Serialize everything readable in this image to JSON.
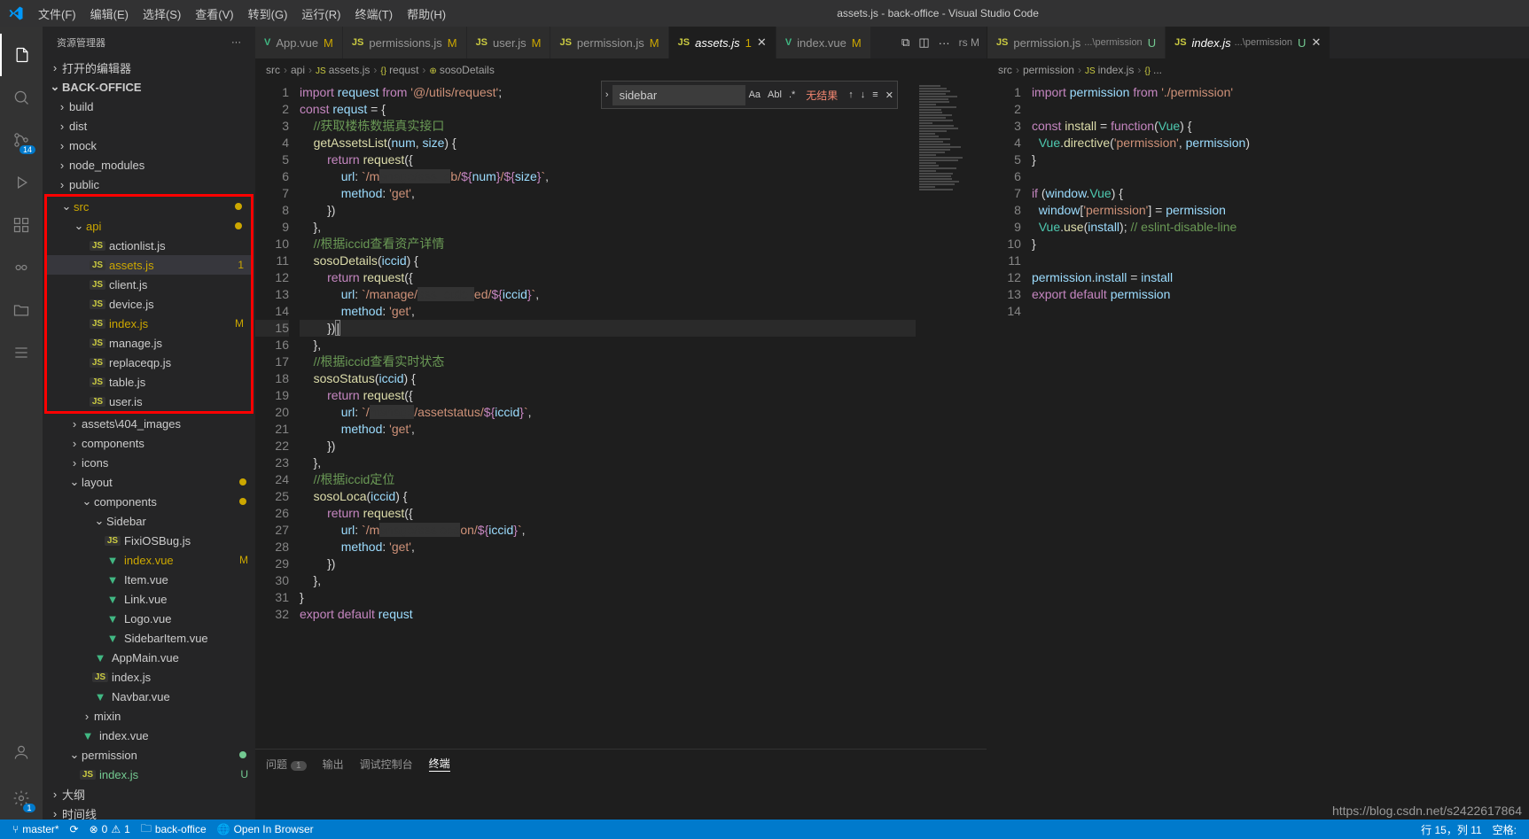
{
  "window_title": "assets.js - back-office - Visual Studio Code",
  "menu": [
    "文件(F)",
    "编辑(E)",
    "选择(S)",
    "查看(V)",
    "转到(G)",
    "运行(R)",
    "终端(T)",
    "帮助(H)"
  ],
  "activitybar": {
    "scm_badge": "14",
    "gear_badge": "1"
  },
  "sidebar": {
    "title": "资源管理器",
    "open_editors": "打开的编辑器",
    "workspace": "BACK-OFFICE",
    "folders_top": [
      "build",
      "dist",
      "mock",
      "node_modules",
      "public"
    ],
    "src": "src",
    "api": "api",
    "api_files": [
      {
        "n": "actionlist.js"
      },
      {
        "n": "assets.js",
        "sel": true,
        "b": "1"
      },
      {
        "n": "client.js"
      },
      {
        "n": "device.js"
      },
      {
        "n": "index.js",
        "b": "M"
      },
      {
        "n": "manage.js"
      },
      {
        "n": "replaceqp.js"
      },
      {
        "n": "table.js"
      },
      {
        "n": "user.is"
      }
    ],
    "after": [
      {
        "n": "assets\\404_images",
        "t": "folder",
        "ch": ">"
      },
      {
        "n": "components",
        "t": "folder",
        "ch": ">"
      },
      {
        "n": "icons",
        "t": "folder",
        "ch": ">"
      },
      {
        "n": "layout",
        "t": "folder",
        "ch": "v",
        "dot": "#cca700"
      },
      {
        "n": "components",
        "t": "folder",
        "ch": "v",
        "pad": 1,
        "dot": "#cca700"
      },
      {
        "n": "Sidebar",
        "t": "folder",
        "ch": "v",
        "pad": 2
      },
      {
        "n": "FixiOSBug.js",
        "t": "js",
        "pad": 3
      },
      {
        "n": "index.vue",
        "t": "vue",
        "pad": 3,
        "b": "M"
      },
      {
        "n": "Item.vue",
        "t": "vue",
        "pad": 3
      },
      {
        "n": "Link.vue",
        "t": "vue",
        "pad": 3
      },
      {
        "n": "Logo.vue",
        "t": "vue",
        "pad": 3
      },
      {
        "n": "SidebarItem.vue",
        "t": "vue",
        "pad": 3
      },
      {
        "n": "AppMain.vue",
        "t": "vue",
        "pad": 2
      },
      {
        "n": "index.js",
        "t": "js",
        "pad": 2
      },
      {
        "n": "Navbar.vue",
        "t": "vue",
        "pad": 2
      },
      {
        "n": "mixin",
        "t": "folder",
        "ch": ">",
        "pad": 1
      },
      {
        "n": "index.vue",
        "t": "vue",
        "pad": 1
      },
      {
        "n": "permission",
        "t": "folder",
        "ch": "v",
        "dot": "#73c991"
      },
      {
        "n": "index.js",
        "t": "js",
        "pad": 1,
        "b": "U",
        "bc": "#73c991"
      }
    ],
    "outline": "大纲",
    "timeline": "时间线"
  },
  "tabs1": [
    {
      "i": "V",
      "ic": "#41b883",
      "n": "App.vue",
      "m": "M"
    },
    {
      "i": "JS",
      "ic": "#cbcb41",
      "n": "permissions.js",
      "m": "M"
    },
    {
      "i": "JS",
      "ic": "#cbcb41",
      "n": "user.js",
      "m": "M"
    },
    {
      "i": "JS",
      "ic": "#cbcb41",
      "n": "permission.js",
      "m": "M"
    },
    {
      "i": "JS",
      "ic": "#cbcb41",
      "n": "assets.js",
      "m": "1",
      "active": true,
      "close": true
    },
    {
      "i": "V",
      "ic": "#41b883",
      "n": "index.vue",
      "m": "M"
    }
  ],
  "tabs1_over": "rs  M",
  "tabs2": [
    {
      "i": "JS",
      "ic": "#cbcb41",
      "n": "permission.js",
      "sub": "...\\permission",
      "m": "U",
      "mc": "#73c991"
    },
    {
      "i": "JS",
      "ic": "#cbcb41",
      "n": "index.js",
      "sub": "...\\permission",
      "m": "U",
      "mc": "#73c991",
      "active": true,
      "close": true
    }
  ],
  "breadcrumb1": [
    "src",
    "api",
    "assets.js",
    "requst",
    "sosoDetails"
  ],
  "breadcrumb2": [
    "src",
    "permission",
    "index.js",
    "..."
  ],
  "find": {
    "value": "sidebar",
    "result": "无结果",
    "opts": [
      "Aa",
      "Abl",
      ".*"
    ]
  },
  "code1": [
    "<span class='k'>import</span> <span class='v'>request</span> <span class='k'>from</span> <span class='s'>'@/utils/request'</span>;",
    "<span class='k'>const</span> <span class='v'>requst</span> = {",
    "    <span class='c'>//获取楼栋数据真实接口</span>",
    "    <span class='fn'>getAssetsList</span>(<span class='v'>num</span>, <span class='v'>size</span>) {",
    "        <span class='k'>return</span> <span class='fn'>request</span>({",
    "            <span class='v'>url</span>: <span class='s'>`/m<span style='background:#333;color:#333'>anage/ass  e</span>b/</span><span class='k'>${</span><span class='v'>num</span><span class='k'>}</span><span class='s'>/</span><span class='k'>${</span><span class='v'>size</span><span class='k'>}</span><span class='s'>`</span>,",
    "            <span class='v'>method</span>: <span class='s'>'get'</span>,",
    "        })",
    "    },",
    "    <span class='c'>//根据iccid查看资产详情</span>",
    "    <span class='fn'>sosoDetails</span>(<span class='v'>iccid</span>) {",
    "        <span class='k'>return</span> <span class='fn'>request</span>({",
    "            <span class='v'>url</span>: <span class='s'>`/manage/<span style='background:#333;color:#333'>ass  etde i</span>ed/</span><span class='k'>${</span><span class='v'>iccid</span><span class='k'>}</span><span class='s'>`</span>,",
    "            <span class='v'>method</span>: <span class='s'>'get'</span>,",
    "        })<span style='border:1px solid #888'>|</span>",
    "    },",
    "    <span class='c'>//根据iccid查看实时状态</span>",
    "    <span class='fn'>sosoStatus</span>(<span class='v'>iccid</span>) {",
    "        <span class='k'>return</span> <span class='fn'>request</span>({",
    "            <span class='v'>url</span>: <span class='s'>`/<span style='background:#333;color:#333'>manage</span>/assetstatus/</span><span class='k'>${</span><span class='v'>iccid</span><span class='k'>}</span><span class='s'>`</span>,",
    "            <span class='v'>method</span>: <span class='s'>'get'</span>,",
    "        })",
    "    },",
    "    <span class='c'>//根据iccid定位</span>",
    "    <span class='fn'>sosoLoca</span>(<span class='v'>iccid</span>) {",
    "        <span class='k'>return</span> <span class='fn'>request</span>({",
    "            <span class='v'>url</span>: <span class='s'>`/m<span style='background:#333;color:#333'>anage/ass oca</span>on/</span><span class='k'>${</span><span class='v'>iccid</span><span class='k'>}</span><span class='s'>`</span>,",
    "            <span class='v'>method</span>: <span class='s'>'get'</span>,",
    "        })",
    "    },",
    "}",
    "<span class='k'>export</span> <span class='k'>default</span> <span class='v'>requst</span>"
  ],
  "code2": [
    "<span class='k'>import</span> <span class='v'>permission</span> <span class='k'>from</span> <span class='s'>'./permission'</span>",
    "",
    "<span class='k'>const</span> <span class='fn'>install</span> = <span class='k'>function</span>(<span class='t'>Vue</span>) {",
    "  <span class='t'>Vue</span>.<span class='fn'>directive</span>(<span class='s'>'permission'</span>, <span class='v'>permission</span>)",
    "}",
    "",
    "<span class='k'>if</span> (<span class='v'>window</span>.<span class='t'>Vue</span>) {",
    "  <span class='v'>window</span>[<span class='s'>'permission'</span>] = <span class='v'>permission</span>",
    "  <span class='t'>Vue</span>.<span class='fn'>use</span>(<span class='v'>install</span>); <span class='c'>// eslint-disable-line</span>",
    "}",
    "",
    "<span class='v'>permission</span>.<span class='v'>install</span> = <span class='v'>install</span>",
    "<span class='k'>export</span> <span class='k'>default</span> <span class='v'>permission</span>",
    ""
  ],
  "panel": {
    "tabs": [
      "问题",
      "输出",
      "调试控制台",
      "终端"
    ],
    "problem_count": "1",
    "active": "终端"
  },
  "statusbar": {
    "branch": "master*",
    "errors": "0",
    "warnings": "1",
    "folder": "back-office",
    "open_browser": "Open In Browser",
    "cursor": "行 15，列 11",
    "spaces": "空格:",
    "watermark": "https://blog.csdn.net/s2422617864"
  }
}
